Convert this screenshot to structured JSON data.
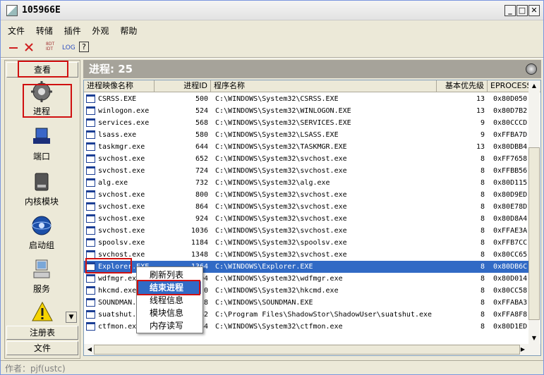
{
  "window": {
    "title": "105966E"
  },
  "menu": {
    "items": [
      "文件",
      "转储",
      "插件",
      "外观",
      "帮助"
    ]
  },
  "toolbar": {
    "buttons": [
      "minus-icon",
      "close-x-icon",
      "8dt-idt-icon",
      "LOG",
      "help-icon"
    ]
  },
  "toolbar_labels": {
    "sdt": "8DT\nIDT",
    "log": "LOG",
    "help": "?"
  },
  "sidebar": {
    "header": "查看",
    "items": [
      {
        "label": "进程",
        "icon": "gear-icon"
      },
      {
        "label": "端口",
        "icon": "network-icon"
      },
      {
        "label": "内核模块",
        "icon": "disk-icon"
      },
      {
        "label": "启动组",
        "icon": "globe-icon"
      },
      {
        "label": "服务",
        "icon": "computer-icon"
      }
    ],
    "footer_registry": "注册表",
    "footer_file": "文件"
  },
  "process_panel": {
    "header": "进程: 25"
  },
  "table": {
    "columns": [
      "进程映像名称",
      "进程ID",
      "程序名称",
      "基本优先级",
      "EPROCESS"
    ],
    "rows": [
      [
        "CSRSS.EXE",
        "500",
        "C:\\WINDOWS\\System32\\CSRSS.EXE",
        "13",
        "0x80D050"
      ],
      [
        "winlogon.exe",
        "524",
        "C:\\WINDOWS\\System32\\WINLOGON.EXE",
        "13",
        "0x80D7B2"
      ],
      [
        "services.exe",
        "568",
        "C:\\WINDOWS\\System32\\SERVICES.EXE",
        "9",
        "0x80CCCD"
      ],
      [
        "lsass.exe",
        "580",
        "C:\\WINDOWS\\System32\\LSASS.EXE",
        "9",
        "0xFFBA7D"
      ],
      [
        "taskmgr.exe",
        "644",
        "C:\\WINDOWS\\System32\\TASKMGR.EXE",
        "13",
        "0x80DBB4"
      ],
      [
        "svchost.exe",
        "652",
        "C:\\WINDOWS\\System32\\svchost.exe",
        "8",
        "0xFF7658"
      ],
      [
        "svchost.exe",
        "724",
        "C:\\WINDOWS\\System32\\svchost.exe",
        "8",
        "0xFFBB56"
      ],
      [
        "alg.exe",
        "732",
        "C:\\WINDOWS\\System32\\alg.exe",
        "8",
        "0x80D115"
      ],
      [
        "svchost.exe",
        "800",
        "C:\\WINDOWS\\System32\\svchost.exe",
        "8",
        "0x80D9ED"
      ],
      [
        "svchost.exe",
        "864",
        "C:\\WINDOWS\\System32\\svchost.exe",
        "8",
        "0x80E78D"
      ],
      [
        "svchost.exe",
        "924",
        "C:\\WINDOWS\\System32\\svchost.exe",
        "8",
        "0x80D8A4"
      ],
      [
        "svchost.exe",
        "1036",
        "C:\\WINDOWS\\System32\\svchost.exe",
        "8",
        "0xFFAE3A"
      ],
      [
        "spoolsv.exe",
        "1184",
        "C:\\WINDOWS\\System32\\spoolsv.exe",
        "8",
        "0xFFB7CC"
      ],
      [
        "svchost.exe",
        "1348",
        "C:\\WINDOWS\\System32\\svchost.exe",
        "8",
        "0x80CC65"
      ],
      [
        "Explorer.EXE",
        "1364",
        "C:\\WINDOWS\\Explorer.EXE",
        "8",
        "0x80DB6C"
      ],
      [
        "wdfmgr.exe",
        "1404",
        "C:\\WINDOWS\\System32\\wdfmgr.exe",
        "8",
        "0x80D014"
      ],
      [
        "hkcmd.exe",
        "1420",
        "C:\\WINDOWS\\System32\\hkcmd.exe",
        "8",
        "0x80CC58"
      ],
      [
        "SOUNDMAN.EXE",
        "1428",
        "C:\\WINDOWS\\SOUNDMAN.EXE",
        "8",
        "0xFFABA3"
      ],
      [
        "suatshut.exe",
        "1432",
        "C:\\Program Files\\ShadowStor\\ShadowUser\\suatshut.exe",
        "8",
        "0xFFA8F8"
      ],
      [
        "ctfmon.exe",
        "1444",
        "C:\\WINDOWS\\System32\\ctfmon.exe",
        "8",
        "0x80D1ED"
      ]
    ],
    "selected_index": 14
  },
  "context_menu": {
    "items": [
      "刷新列表",
      "结束进程",
      "线程信息",
      "模块信息",
      "内存读写"
    ],
    "active_index": 1
  },
  "statusbar": {
    "text": "作者：pjf(ustc)"
  },
  "colors": {
    "selection": "#316ac5",
    "highlight_box": "#d01010",
    "header_bar": "#a6a39a"
  }
}
